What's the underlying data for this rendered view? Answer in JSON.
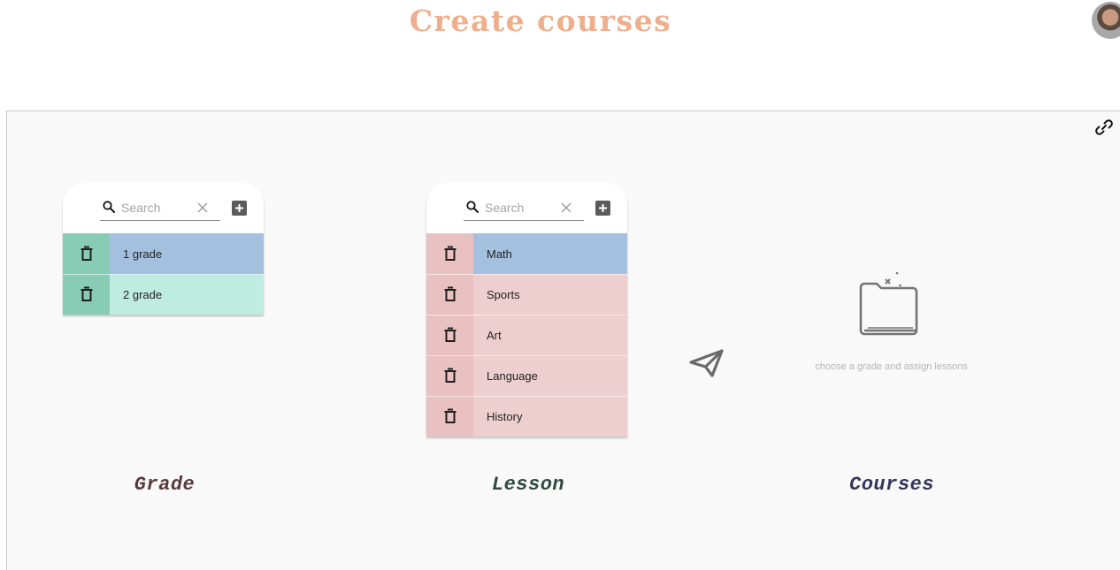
{
  "header": {
    "title": "Create courses"
  },
  "grade": {
    "search_placeholder": "Search",
    "items": [
      {
        "label": "1 grade",
        "selected": true
      },
      {
        "label": "2 grade",
        "selected": false
      }
    ],
    "column_label": "Grade"
  },
  "lesson": {
    "search_placeholder": "Search",
    "items": [
      {
        "label": "Math",
        "selected": true
      },
      {
        "label": "Sports",
        "selected": false
      },
      {
        "label": "Art",
        "selected": false
      },
      {
        "label": "Language",
        "selected": false
      },
      {
        "label": "History",
        "selected": false
      }
    ],
    "column_label": "Lesson"
  },
  "courses": {
    "empty_text": "choose a grade and assign lessons",
    "column_label": "Courses"
  },
  "colors": {
    "title": "#efaf8c",
    "grade_delete": "#88ccb5",
    "grade_row": "#bfece0",
    "lesson_delete": "#e9c1c1",
    "lesson_row": "#eccfce",
    "selected_row": "#a3c1df",
    "grade_label": "#5a3a3a",
    "lesson_label": "#2f4a3e",
    "courses_label": "#35345a"
  },
  "icons": {
    "link": "link-icon",
    "search": "search-icon",
    "clear": "close-icon",
    "add": "add-box-icon",
    "delete": "trash-icon",
    "send": "send-icon",
    "empty": "empty-folder-icon"
  }
}
